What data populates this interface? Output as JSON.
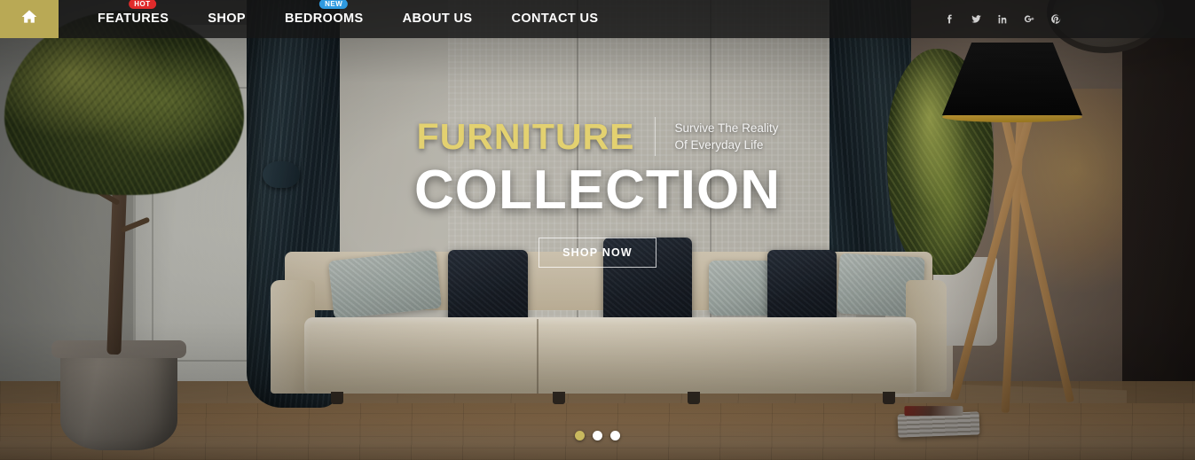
{
  "navbar": {
    "home_icon": "home-icon",
    "items": [
      {
        "label": "FEATURES",
        "badge": "HOT",
        "badge_type": "hot"
      },
      {
        "label": "SHOP",
        "badge": null,
        "badge_type": null
      },
      {
        "label": "BEDROOMS",
        "badge": "NEW",
        "badge_type": "new"
      },
      {
        "label": "ABOUT US",
        "badge": null,
        "badge_type": null
      },
      {
        "label": "CONTACT US",
        "badge": null,
        "badge_type": null
      }
    ],
    "social": [
      {
        "name": "facebook-icon",
        "glyph": "f"
      },
      {
        "name": "twitter-icon",
        "glyph": "t"
      },
      {
        "name": "linkedin-icon",
        "glyph": "in"
      },
      {
        "name": "googleplus-icon",
        "glyph": "G+"
      },
      {
        "name": "pinterest-icon",
        "glyph": "p"
      }
    ],
    "accent_color": "#b9a955",
    "background_color": "rgba(22,22,22,0.82)"
  },
  "hero": {
    "title_accent": "FURNITURE",
    "tagline_line1": "Survive The Reality",
    "tagline_line2": "Of Everyday Life",
    "title_main": "COLLECTION",
    "cta_label": "SHOP NOW",
    "accent_color": "#e3d170",
    "main_color": "#ffffff"
  },
  "carousel": {
    "slide_count": 3,
    "active_index": 0,
    "active_color": "#c9b95e",
    "inactive_color": "#ffffff"
  },
  "scene": {
    "description": "Living room interior photograph: cream sofa with grey and navy cushions, dark teal curtains, potted tree at left, tripod floor lamp with black shade at right, wooden floor"
  }
}
